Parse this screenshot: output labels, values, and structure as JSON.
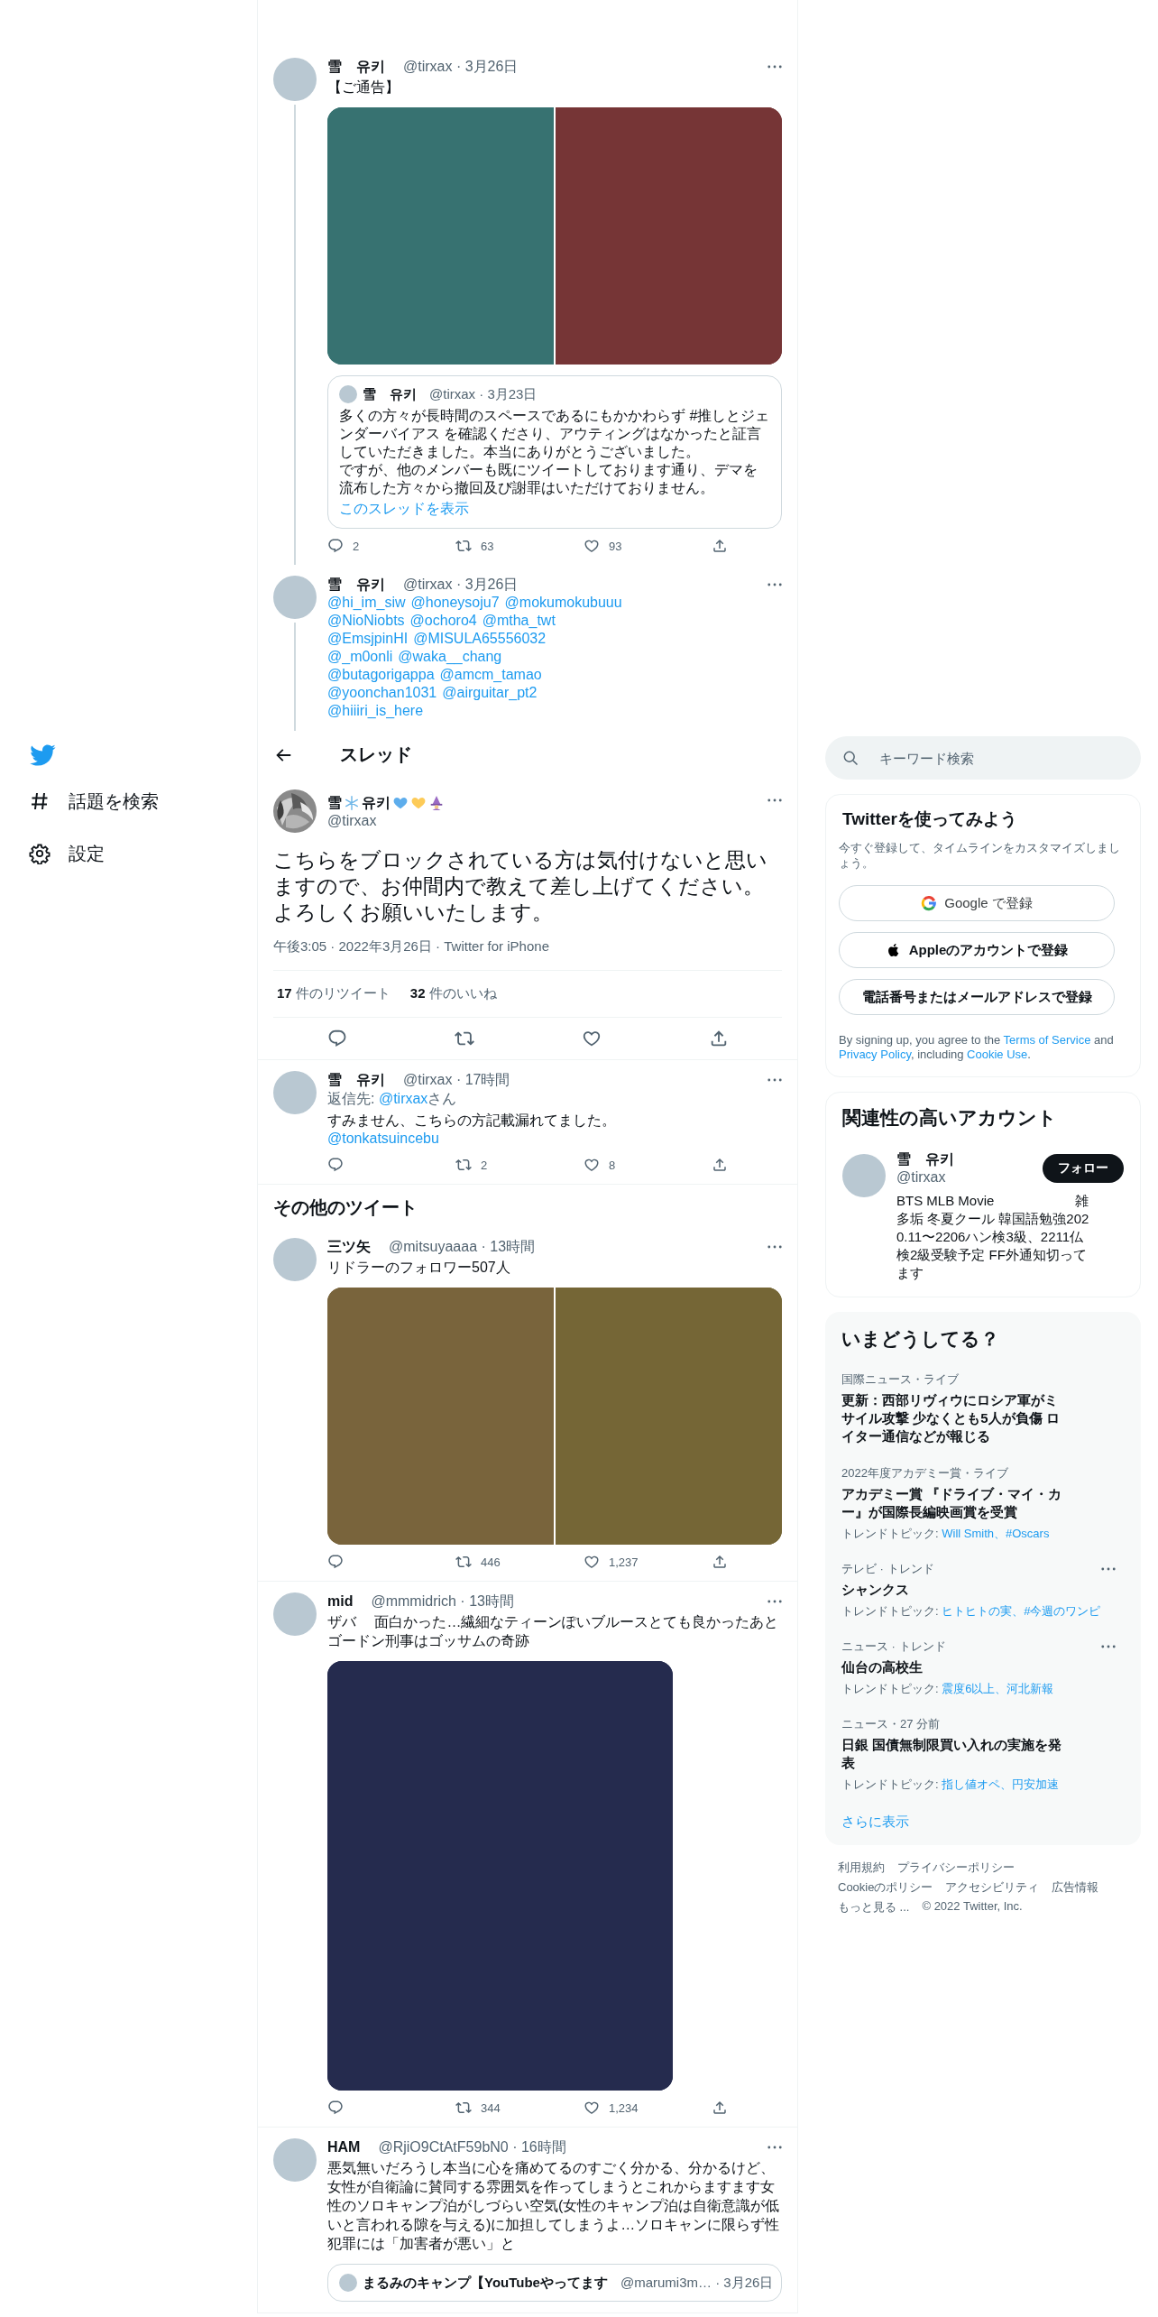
{
  "nav": [
    {
      "kind": "logo"
    },
    {
      "kind": "explore",
      "label": "話題を検索"
    },
    {
      "kind": "settings",
      "label": "設定"
    }
  ],
  "main": [
    {
      "kind": "tweet",
      "thread_line": true,
      "name": "雪　유키",
      "meta": "@tirxax · 3月26日",
      "lines": [
        {
          "kind": "text",
          "text": "【ご通告】"
        }
      ],
      "media": {
        "items": [
          {
            "color": "#377271"
          },
          {
            "color": "#763536"
          }
        ]
      },
      "quote": {
        "name": "雪　유키",
        "meta": "@tirxax · 3月23日",
        "paragraphs": [
          "多くの方々が長時間のスペースであるにもかかわらず #推しとジェンダーバイアス を確認くださり、アウティングはなかったと証言していただきました。本当にありがとうございました。",
          "ですが、他のメンバーも既にツイートしております通り、デマを流布した方々から撤回及び謝罪はいただけておりません。"
        ],
        "link": "このスレッドを表示"
      },
      "stats": {
        "reply": "2",
        "retweet": "63",
        "like": "93"
      }
    },
    {
      "kind": "tweet",
      "thread_line": true,
      "name": "雪　유키",
      "meta": "@tirxax · 3月26日",
      "lines": [
        {
          "kind": "mentions",
          "items": [
            "@hi_im_siw",
            "@honeysoju7",
            "@mokumokubuuu"
          ]
        },
        {
          "kind": "mentions",
          "items": [
            "@NioNiobts",
            "@ochoro4",
            "@mtha_twt"
          ]
        },
        {
          "kind": "mentions",
          "items": [
            "@EmsjpinHI",
            "@MISULA65556032"
          ]
        },
        {
          "kind": "mentions",
          "items": [
            "@_m0onli",
            "@waka__chang"
          ]
        },
        {
          "kind": "mentions",
          "items": [
            "@butagorigappa",
            "@amcm_tamao"
          ]
        },
        {
          "kind": "mentions",
          "items": [
            "@yoonchan1031",
            "@airguitar_pt2"
          ]
        },
        {
          "kind": "mentions",
          "items": [
            "@hiiiri_is_here"
          ]
        }
      ]
    },
    {
      "kind": "header",
      "title": "スレッド"
    },
    {
      "kind": "focus",
      "name_parts": [
        "雪",
        "유키"
      ],
      "handle": "@tirxax",
      "text": "こちらをブロックされている方は気付けないと思いますので、お仲間内で教えて差し上げてください。よろしくお願いいたします。",
      "meta": "午後3:05 · 2022年3月26日 · Twitter for iPhone",
      "stats": [
        {
          "count": "17",
          "label": "件のリツイート"
        },
        {
          "count": "32",
          "label": "件のいいね"
        }
      ]
    },
    {
      "kind": "tweet",
      "thread_line": false,
      "name": "雪　유키",
      "meta": "@tirxax · 17時間",
      "lines": [
        {
          "kind": "reply_to",
          "label": "返信先:",
          "link": "@tirxax",
          "suffix": "さん"
        },
        {
          "kind": "text",
          "text": "すみません、こちらの方記載漏れてました。"
        },
        {
          "kind": "mentions",
          "items": [
            "@tonkatsuincebu"
          ]
        }
      ],
      "stats": {
        "retweet": "2",
        "like": "8"
      }
    },
    {
      "kind": "heading",
      "title": "その他のツイート"
    },
    {
      "kind": "tweet",
      "thread_line": false,
      "name": "三ツ矢",
      "meta": "@mitsuyaaaa · 13時間",
      "lines": [
        {
          "kind": "text",
          "text": "リドラーのフォロワー507人"
        }
      ],
      "media": {
        "items": [
          {
            "color": "#79643c"
          },
          {
            "color": "#756636"
          }
        ]
      },
      "stats": {
        "retweet": "446",
        "like": "1,237"
      }
    },
    {
      "kind": "tweet",
      "thread_line": false,
      "name": "mid",
      "meta": "@mmmidrich · 13時間",
      "lines": [
        {
          "kind": "text",
          "text": "ザバ　 面白かった…繊細なティーンぽいブルースとても良かったあとゴードン刑事はゴッサムの奇跡"
        }
      ],
      "media": {
        "items": [
          {
            "color": "#252b4e"
          }
        ]
      },
      "stats": {
        "retweet": "344",
        "like": "1,234"
      }
    },
    {
      "kind": "tweet",
      "thread_line": false,
      "name": "HAM",
      "meta": "@RjiO9CtAtF59bN0 · 16時間",
      "lines": [
        {
          "kind": "text",
          "text": "悪気無いだろうし本当に心を痛めてるのすごく分かる、分かるけど、女性が自衛論に賛同する雰囲気を作ってしまうとこれからますます女性のソロキャンプ泊がしづらい空気(女性のキャンプ泊は自衛意識が低いと言われる隙を与える)に加担してしまうよ…ソロキャンに限らず性犯罪には「加害者が悪い」と"
        }
      ],
      "quote": {
        "name": "まるみのキャンプ【YouTubeやってます",
        "meta": "@marumi3m… · 3月26日"
      }
    }
  ],
  "search": {
    "placeholder": "キーワード検索"
  },
  "signup": {
    "title": "Twitterを使ってみよう",
    "subtitle": "今すぐ登録して、タイムラインをカスタマイズしましょう。",
    "buttons": [
      {
        "kind": "google",
        "label": "Google で登録"
      },
      {
        "kind": "apple",
        "label": "Appleのアカウントで登録"
      },
      {
        "kind": "plain",
        "label": "電話番号またはメールアドレスで登録"
      }
    ],
    "legal": [
      {
        "text": "By signing up, you agree to the ",
        "link": false
      },
      {
        "text": "Terms of Service",
        "link": true
      },
      {
        "text": " and ",
        "link": false
      },
      {
        "text": "Privacy Policy",
        "link": true
      },
      {
        "text": ", including ",
        "link": false
      },
      {
        "text": "Cookie Use",
        "link": true
      },
      {
        "text": ".",
        "link": false
      }
    ]
  },
  "related": {
    "title": "関連性の高いアカウント",
    "accounts": [
      {
        "name": "雪　유키",
        "handle": "@tirxax",
        "button": "フォロー",
        "bio": "BTS MLB Movie　　　　　　雑多垢 冬夏クール 韓国語勉強2020.11〜2206ハン検3級、2211仏検2級受験予定 FF外通知切ってます"
      }
    ]
  },
  "trends": {
    "title": "いまどうしてる？",
    "items": [
      {
        "category": "国際ニュース・ライブ",
        "title": "更新：西部リヴィウにロシア軍がミサイル攻撃 少なくとも5人が負傷 ロイター通信などが報じる",
        "menu": false
      },
      {
        "category": "2022年度アカデミー賞・ライブ",
        "title": "アカデミー賞 『ドライブ・マイ・カー』が国際長編映画賞を受賞",
        "topics_label": "トレンドトピック:",
        "topics": "Will Smith、#Oscars",
        "menu": false
      },
      {
        "category": "テレビ · トレンド",
        "title": "シャンクス",
        "topics_label": "トレンドトピック:",
        "topics": "ヒトヒトの実、#今週のワンピ",
        "menu": true
      },
      {
        "category": "ニュース · トレンド",
        "title": "仙台の高校生",
        "topics_label": "トレンドトピック:",
        "topics": "震度6以上、河北新報",
        "menu": true
      },
      {
        "category": "ニュース・27 分前",
        "title": "日銀 国債無制限買い入れの実施を発表",
        "topics_label": "トレンドトピック:",
        "topics": "指し値オペ、円安加速",
        "menu": false
      }
    ],
    "more": "さらに表示"
  },
  "footer": [
    "利用規約",
    "プライバシーポリシー",
    "Cookieのポリシー",
    "アクセシビリティ",
    "広告情報",
    "もっと見る ...",
    "© 2022 Twitter, Inc."
  ]
}
